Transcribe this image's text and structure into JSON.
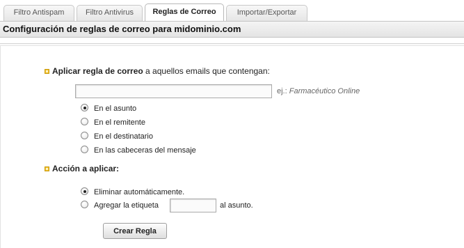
{
  "tabs": [
    {
      "label": "Filtro Antispam",
      "active": false
    },
    {
      "label": "Filtro Antivirus",
      "active": false
    },
    {
      "label": "Reglas de Correo",
      "active": true
    },
    {
      "label": "Importar/Exportar",
      "active": false
    }
  ],
  "header": {
    "title": "Configuración de reglas de correo para midominio.com"
  },
  "rule": {
    "bold": "Aplicar regla de correo",
    "rest": " a aquellos emails que contengan:",
    "input_value": "",
    "hint_prefix": "ej.: ",
    "hint_example": "Farmacéutico Online",
    "options": [
      {
        "label": "En el asunto",
        "checked": true
      },
      {
        "label": "En el remitente",
        "checked": false
      },
      {
        "label": "En el destinatario",
        "checked": false
      },
      {
        "label": "En las cabeceras del mensaje",
        "checked": false
      }
    ]
  },
  "action": {
    "title": "Acción a aplicar:",
    "options": [
      {
        "label": "Eliminar automáticamente.",
        "checked": true
      },
      {
        "label": "Agregar la etiqueta",
        "checked": false
      }
    ],
    "tag_value": "",
    "suffix": "al asunto."
  },
  "buttons": {
    "create": "Crear Regla"
  },
  "colors": {
    "bullet": "#f2c02c",
    "header_bg": "#e9e9e9",
    "border": "#c4c4c4"
  }
}
